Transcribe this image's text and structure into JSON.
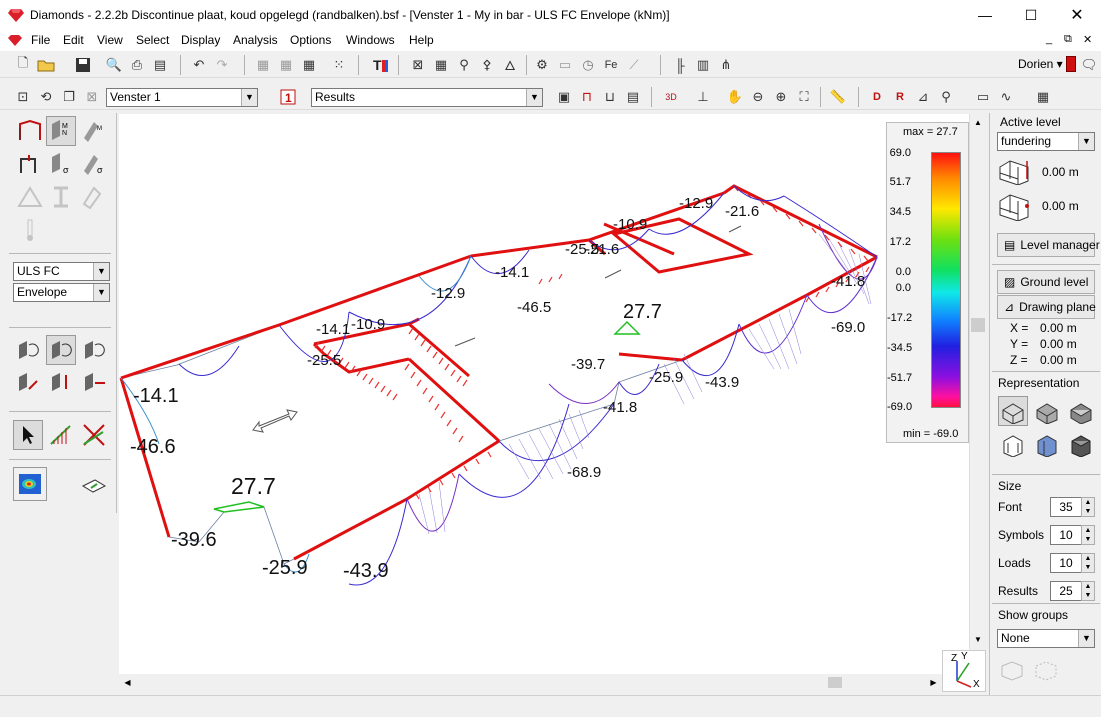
{
  "window": {
    "app_name": "Diamonds",
    "title": "Diamonds  -  2.2.2b Discontinue plaat, koud opgelegd (randbalken).bsf - [Venster 1 - My in bar - ULS FC Envelope  (kNm)]"
  },
  "menu": [
    "File",
    "Edit",
    "View",
    "Select",
    "Display",
    "Analysis",
    "Options",
    "Windows",
    "Help"
  ],
  "user": {
    "name": "Dorien ▾"
  },
  "toolbar2": {
    "window_select": "Venster 1",
    "results_select": "Results"
  },
  "left_panel": {
    "load_combo": "ULS FC",
    "envelope": "Envelope"
  },
  "legend": {
    "max_label": "max = 27.7",
    "min_label": "min = -69.0",
    "ticks": [
      "69.0",
      "51.7",
      "34.5",
      "17.2",
      "0.0",
      "0.0",
      "-17.2",
      "-34.5",
      "-51.7",
      "-69.0"
    ]
  },
  "right_panel": {
    "active_level_label": "Active level",
    "level_select": "fundering",
    "level_upper": "0.00 m",
    "level_lower": "0.00 m",
    "level_manager": "Level manager",
    "ground_level": "Ground level",
    "drawing_plane": "Drawing plane",
    "coords": [
      {
        "axis": "X =",
        "value": "0.00 m"
      },
      {
        "axis": "Y =",
        "value": "0.00 m"
      },
      {
        "axis": "Z =",
        "value": "0.00 m"
      }
    ],
    "representation_label": "Representation",
    "size_label": "Size",
    "sizes": [
      {
        "label": "Font",
        "value": "35"
      },
      {
        "label": "Symbols",
        "value": "10"
      },
      {
        "label": "Loads",
        "value": "10"
      },
      {
        "label": "Results",
        "value": "25"
      }
    ],
    "show_groups_label": "Show groups",
    "groups_select": "None"
  },
  "axis_triad": {
    "z": "Z",
    "y": "Y",
    "x": "X"
  },
  "result_labels": [
    {
      "text": "-14.1",
      "size": "small"
    },
    {
      "text": "-25.5",
      "size": "small"
    },
    {
      "text": "-10.9",
      "size": "small"
    },
    {
      "text": "-12.9",
      "size": "small"
    },
    {
      "text": "-14.1",
      "size": "small"
    },
    {
      "text": "-21.6",
      "size": "small"
    },
    {
      "text": "-46.5",
      "size": "small"
    },
    {
      "text": "-25.5",
      "size": "small"
    },
    {
      "text": "-10.9",
      "size": "small"
    },
    {
      "text": "-12.9",
      "size": "small"
    },
    {
      "text": "-21.6",
      "size": "small"
    },
    {
      "text": "-41.8",
      "size": "small"
    },
    {
      "text": "-69.0",
      "size": "small"
    },
    {
      "text": "27.7",
      "size": "medium"
    },
    {
      "text": "-39.7",
      "size": "small"
    },
    {
      "text": "-25.9",
      "size": "small"
    },
    {
      "text": "-43.9",
      "size": "small"
    },
    {
      "text": "-41.8",
      "size": "small"
    },
    {
      "text": "-68.9",
      "size": "small"
    },
    {
      "text": "-14.1",
      "size": "medium"
    },
    {
      "text": "-46.6",
      "size": "medium"
    },
    {
      "text": "27.7",
      "size": "large"
    },
    {
      "text": "-39.6",
      "size": "medium"
    },
    {
      "text": "-25.9",
      "size": "medium"
    },
    {
      "text": "-43.9",
      "size": "medium"
    }
  ],
  "colors": {
    "titlebar": "#ffffff",
    "beam": "#e01010",
    "support": "#e83030",
    "envelope": "#3a2ad0"
  }
}
